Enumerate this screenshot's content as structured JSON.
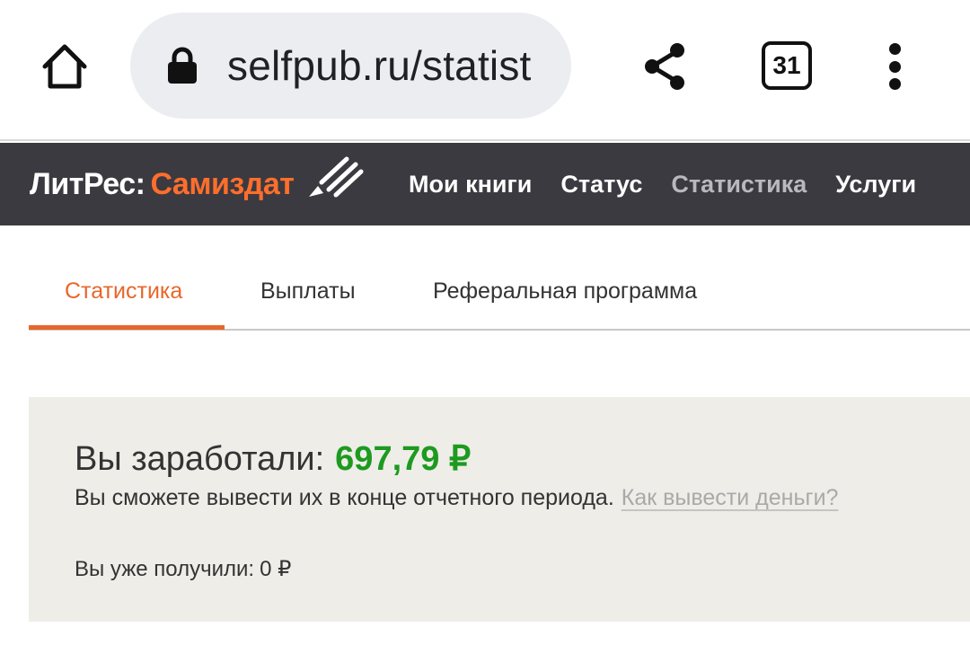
{
  "browser": {
    "url": "selfpub.ru/statist",
    "tab_count": "31",
    "icons": {
      "home": "home-icon",
      "lock": "lock-icon",
      "share": "share-icon",
      "tabs": "tabs-counter-icon",
      "menu": "more-vert-icon"
    }
  },
  "header": {
    "logo_part1": "ЛитРес:",
    "logo_part2": "Самиздат",
    "nav": [
      {
        "label": "Мои книги",
        "active": false
      },
      {
        "label": "Статус",
        "active": false
      },
      {
        "label": "Статистика",
        "active": true
      },
      {
        "label": "Услуги",
        "active": false
      }
    ]
  },
  "tabs": [
    {
      "label": "Статистика",
      "active": true
    },
    {
      "label": "Выплаты",
      "active": false
    },
    {
      "label": "Реферальная программа",
      "active": false
    }
  ],
  "earnings": {
    "title": "Вы заработали:",
    "amount": "697,79 ₽",
    "note": "Вы сможете вывести их в конце отчетного периода.",
    "link": "Как вывести деньги?",
    "received_label": "Вы уже получили:",
    "received_value": "0 ₽"
  },
  "colors": {
    "accent": "#e8662a",
    "logo_accent": "#ff6e2c",
    "header_bg": "#3b3a40",
    "amount_green": "#1d9a1f",
    "panel_bg": "#eeede8"
  }
}
